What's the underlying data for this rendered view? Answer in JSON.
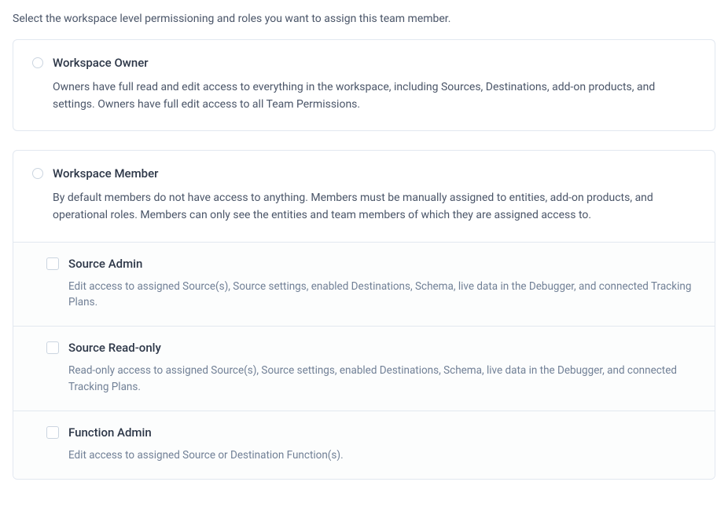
{
  "intro": "Select the workspace level permissioning and roles you want to assign this team member.",
  "roles": {
    "owner": {
      "title": "Workspace Owner",
      "description": "Owners have full read and edit access to everything in the workspace, including Sources, Destinations, add-on products, and settings. Owners have full edit access to all Team Permissions."
    },
    "member": {
      "title": "Workspace Member",
      "description": "By default members do not have access to anything. Members must be manually assigned to entities, add-on products, and operational roles. Members can only see the entities and team members of which they are assigned access to.",
      "subroles": {
        "source_admin": {
          "title": "Source Admin",
          "description": "Edit access to assigned Source(s), Source settings, enabled Destinations, Schema, live data in the Debugger, and connected Tracking Plans."
        },
        "source_readonly": {
          "title": "Source Read-only",
          "description": "Read-only access to assigned Source(s), Source settings, enabled Destinations, Schema, live data in the Debugger, and connected Tracking Plans."
        },
        "function_admin": {
          "title": "Function Admin",
          "description": "Edit access to assigned Source or Destination Function(s)."
        }
      }
    }
  }
}
